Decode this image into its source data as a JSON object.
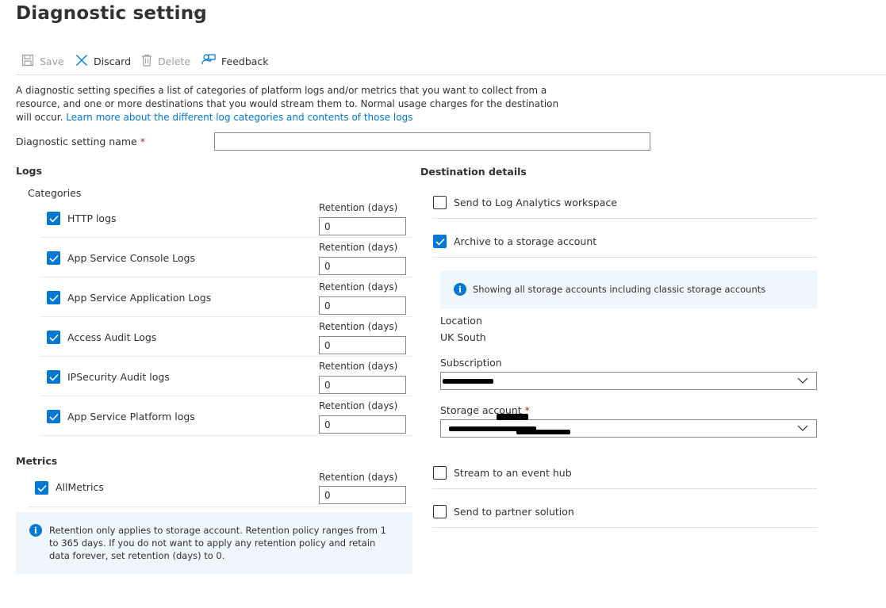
{
  "page": {
    "title": "Diagnostic setting",
    "more": "···"
  },
  "toolbar": {
    "save": "Save",
    "discard": "Discard",
    "delete": "Delete",
    "feedback": "Feedback"
  },
  "description": {
    "text": "A diagnostic setting specifies a list of categories of platform logs and/or metrics that you want to collect from a resource, and one or more destinations that you would stream them to. Normal usage charges for the destination will occur.",
    "link": "Learn more about the different log categories and contents of those logs"
  },
  "setting_name": {
    "label": "Diagnostic setting name",
    "required_marker": "*",
    "value": ""
  },
  "logs": {
    "title": "Logs",
    "categories_label": "Categories",
    "retention_label": "Retention (days)",
    "items": [
      {
        "label": "HTTP logs",
        "checked": true,
        "retention": "0"
      },
      {
        "label": "App Service Console Logs",
        "checked": true,
        "retention": "0"
      },
      {
        "label": "App Service Application Logs",
        "checked": true,
        "retention": "0"
      },
      {
        "label": "Access Audit Logs",
        "checked": true,
        "retention": "0"
      },
      {
        "label": "IPSecurity Audit logs",
        "checked": true,
        "retention": "0"
      },
      {
        "label": "App Service Platform logs",
        "checked": true,
        "retention": "0"
      }
    ]
  },
  "metrics": {
    "title": "Metrics",
    "retention_label": "Retention (days)",
    "items": [
      {
        "label": "AllMetrics",
        "checked": true,
        "retention": "0"
      }
    ]
  },
  "retention_note": "Retention only applies to storage account. Retention policy ranges from 1 to 365 days. If you do not want to apply any retention policy and retain data forever, set retention (days) to 0.",
  "destination": {
    "title": "Destination details",
    "log_analytics": {
      "label": "Send to Log Analytics workspace",
      "checked": false
    },
    "storage": {
      "label": "Archive to a storage account",
      "checked": true
    },
    "storage_info": "Showing all storage accounts including classic storage accounts",
    "location_label": "Location",
    "location_value": "UK South",
    "subscription_label": "Subscription",
    "storage_account_label": "Storage account",
    "storage_account_required": "*",
    "event_hub": {
      "label": "Stream to an event hub",
      "checked": false
    },
    "partner": {
      "label": "Send to partner solution",
      "checked": false
    }
  },
  "colors": {
    "accent": "#0078d4",
    "info_bg": "#eff6fc",
    "required": "#a4262c"
  }
}
